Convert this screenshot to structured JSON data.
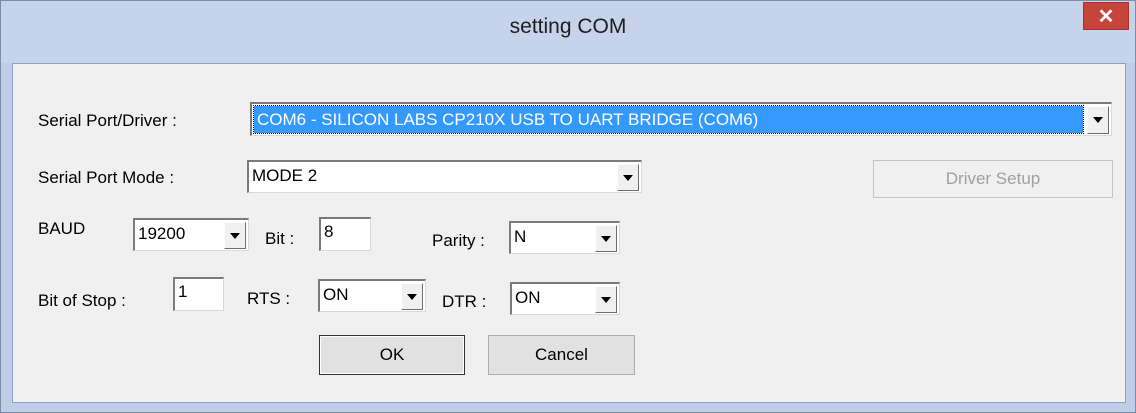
{
  "window": {
    "title": "setting COM",
    "close_glyph": "✕"
  },
  "serial_port": {
    "label": "Serial Port/Driver :",
    "value": "COM6 - SILICON LABS CP210X USB TO UART BRIDGE (COM6)"
  },
  "serial_mode": {
    "label": "Serial Port Mode :",
    "value": "MODE 2"
  },
  "driver_setup": {
    "label": "Driver Setup"
  },
  "baud": {
    "label": "BAUD",
    "value": "19200"
  },
  "bit": {
    "label": "Bit :",
    "value": "8"
  },
  "parity": {
    "label": "Parity :",
    "value": "N"
  },
  "stop": {
    "label": "Bit of Stop :",
    "value": "1"
  },
  "rts": {
    "label": "RTS :",
    "value": "ON"
  },
  "dtr": {
    "label": "DTR :",
    "value": "ON"
  },
  "buttons": {
    "ok": "OK",
    "cancel": "Cancel"
  },
  "colors": {
    "selection": "#3399ff",
    "close": "#c7443a",
    "titlebar": "#c6d3ea"
  },
  "icons": {
    "dropdown": "chevron-down-icon",
    "close": "close-icon"
  }
}
